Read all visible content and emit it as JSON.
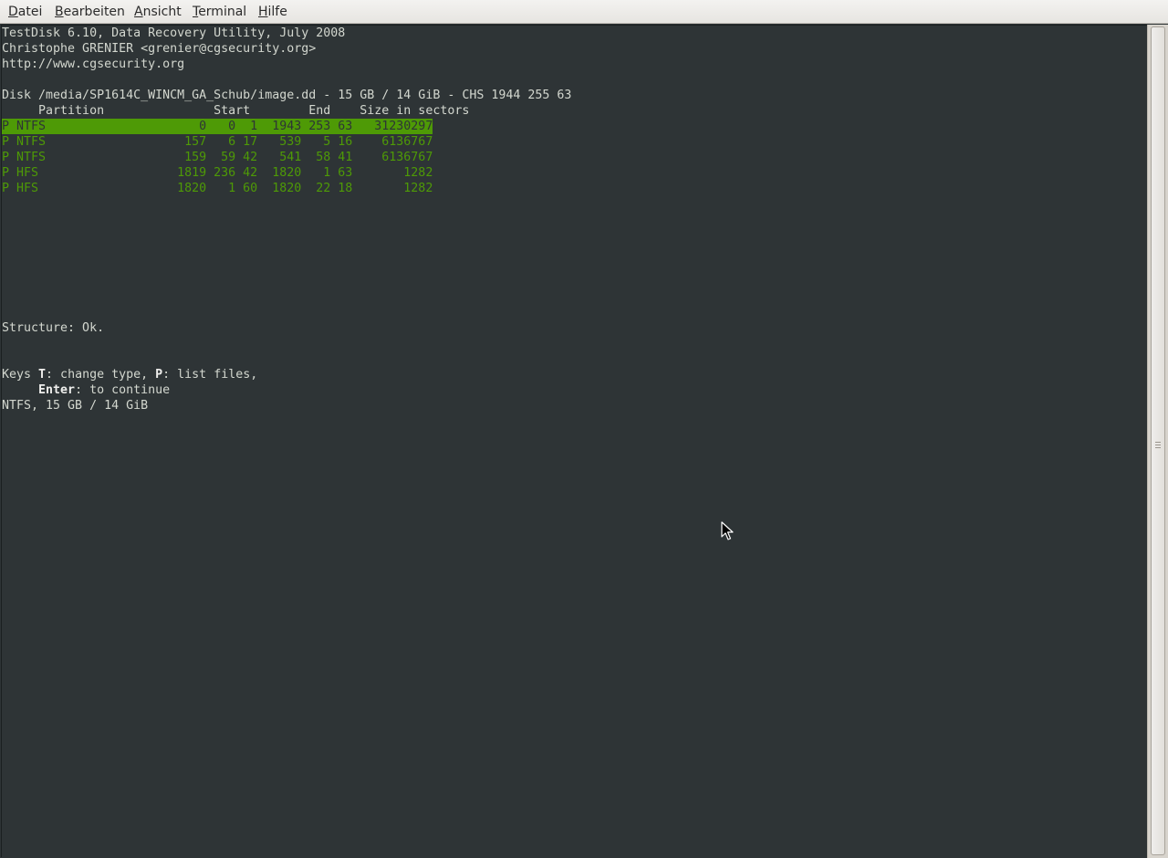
{
  "menubar": {
    "items": [
      {
        "mnemonic": "D",
        "rest": "atei"
      },
      {
        "mnemonic": "B",
        "rest": "earbeiten"
      },
      {
        "mnemonic": "A",
        "rest": "nsicht"
      },
      {
        "mnemonic": "T",
        "rest": "erminal"
      },
      {
        "mnemonic": "H",
        "rest": "ilfe"
      }
    ]
  },
  "terminal": {
    "header": [
      "TestDisk 6.10, Data Recovery Utility, July 2008",
      "Christophe GRENIER <grenier@cgsecurity.org>",
      "http://www.cgsecurity.org"
    ],
    "disk_line": "Disk /media/SP1614C_WINCM_GA_Schub/image.dd - 15 GB / 14 GiB - CHS 1944 255 63",
    "columns_line": "     Partition               Start        End    Size in sectors",
    "partitions": [
      "P NTFS                     0   0  1  1943 253 63   31230297",
      "P NTFS                   157   6 17   539   5 16    6136767",
      "P NTFS                   159  59 42   541  58 41    6136767",
      "P HFS                   1819 236 42  1820   1 63       1282",
      "P HFS                   1820   1 60  1820  22 18       1282"
    ],
    "selected_index": 0,
    "structure": "Structure: Ok.",
    "keys": {
      "prefix": "Keys ",
      "key1": "T",
      "desc1": ": change type, ",
      "key2": "P",
      "desc2": ": list files,",
      "indent": "     ",
      "key3": "Enter",
      "desc3": ": to continue"
    },
    "summary": "NTFS, 15 GB / 14 GiB"
  },
  "colors": {
    "background": "#2e3436",
    "foreground": "#d3d7cf",
    "partition_text": "#4e9a06",
    "highlight": "#4e9a06"
  }
}
